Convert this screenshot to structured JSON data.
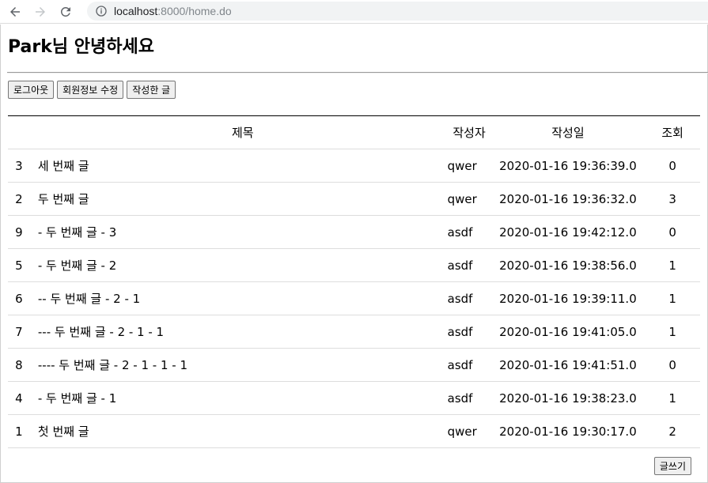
{
  "browser": {
    "url_host": "localhost",
    "url_path": ":8000/home.do"
  },
  "page": {
    "greeting": "Park님 안녕하세요",
    "buttons": {
      "logout": "로그아웃",
      "edit_profile": "회원정보 수정",
      "my_posts": "작성한 글"
    },
    "write_button": "글쓰기"
  },
  "table": {
    "headers": {
      "title": "제목",
      "writer": "작성자",
      "date": "작성일",
      "views": "조회"
    },
    "rows": [
      {
        "no": "3",
        "title": "세 번째 글",
        "writer": "qwer",
        "date": "2020-01-16 19:36:39.0",
        "views": "0"
      },
      {
        "no": "2",
        "title": "두 번째 글",
        "writer": "qwer",
        "date": "2020-01-16 19:36:32.0",
        "views": "3"
      },
      {
        "no": "9",
        "title": "- 두 번째 글 - 3",
        "writer": "asdf",
        "date": "2020-01-16 19:42:12.0",
        "views": "0"
      },
      {
        "no": "5",
        "title": "- 두 번째 글 - 2",
        "writer": "asdf",
        "date": "2020-01-16 19:38:56.0",
        "views": "1"
      },
      {
        "no": "6",
        "title": "-- 두 번째 글 - 2 - 1",
        "writer": "asdf",
        "date": "2020-01-16 19:39:11.0",
        "views": "1"
      },
      {
        "no": "7",
        "title": "--- 두 번째 글 - 2 - 1 - 1",
        "writer": "asdf",
        "date": "2020-01-16 19:41:05.0",
        "views": "1"
      },
      {
        "no": "8",
        "title": "---- 두 번째 글 - 2 - 1 - 1 - 1",
        "writer": "asdf",
        "date": "2020-01-16 19:41:51.0",
        "views": "0"
      },
      {
        "no": "4",
        "title": "- 두 번째 글 - 1",
        "writer": "asdf",
        "date": "2020-01-16 19:38:23.0",
        "views": "1"
      },
      {
        "no": "1",
        "title": "첫 번째 글",
        "writer": "qwer",
        "date": "2020-01-16 19:30:17.0",
        "views": "2"
      }
    ]
  }
}
